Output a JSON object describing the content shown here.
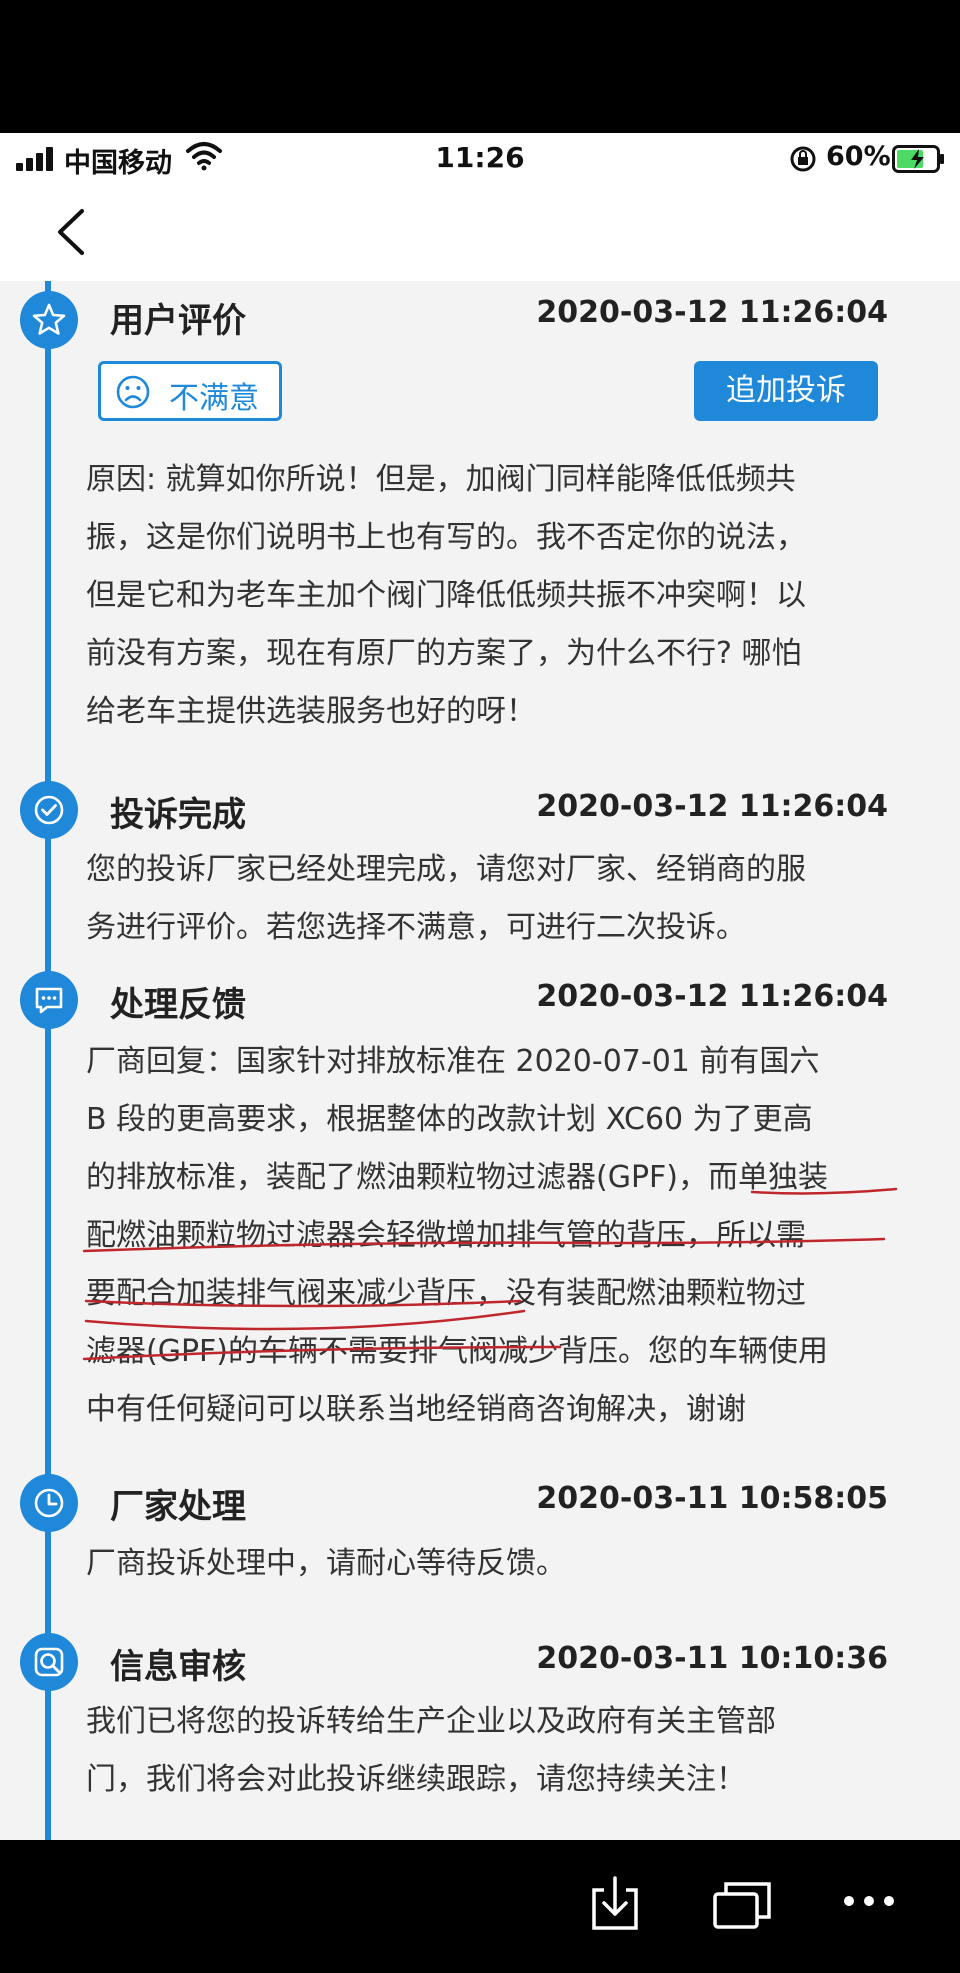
{
  "status_bar": {
    "carrier": "中国移动",
    "time": "11:26",
    "battery_percent": "60%"
  },
  "timeline": [
    {
      "icon": "star-icon",
      "title": "用户评价",
      "timestamp": "2020-03-12 11:26:04",
      "rating_label": "不满意",
      "action_button": "追加投诉",
      "lines": [
        "原因: 就算如你所说！但是，加阀门同样能降低低频共",
        "振，这是你们说明书上也有写的。我不否定你的说法，",
        "但是它和为老车主加个阀门降低低频共振不冲突啊！以",
        "前没有方案，现在有原厂的方案了，为什么不行? 哪怕",
        "给老车主提供选装服务也好的呀！"
      ]
    },
    {
      "icon": "check-circle-icon",
      "title": "投诉完成",
      "timestamp": "2020-03-12 11:26:04",
      "lines": [
        "您的投诉厂家已经处理完成，请您对厂家、经销商的服",
        "务进行评价。若您选择不满意，可进行二次投诉。"
      ]
    },
    {
      "icon": "message-icon",
      "title": "处理反馈",
      "timestamp": "2020-03-12 11:26:04",
      "lines": [
        "厂商回复：国家针对排放标准在 2020-07-01 前有国六",
        "B 段的更高要求，根据整体的改款计划 XC60 为了更高",
        "的排放标准，装配了燃油颗粒物过滤器(GPF)，而单独装",
        "配燃油颗粒物过滤器会轻微增加排气管的背压，所以需",
        "要配合加装排气阀来减少背压，没有装配燃油颗粒物过",
        "滤器(GPF)的车辆不需要排气阀减少背压。您的车辆使用",
        "中有任何疑问可以联系当地经销商咨询解决，谢谢"
      ]
    },
    {
      "icon": "clock-icon",
      "title": "厂家处理",
      "timestamp": "2020-03-11 10:58:05",
      "lines": [
        "厂商投诉处理中，请耐心等待反馈。"
      ]
    },
    {
      "icon": "search-review-icon",
      "title": "信息审核",
      "timestamp": "2020-03-11 10:10:36",
      "lines": [
        "我们已将您的投诉转给生产企业以及政府有关主管部",
        "门，我们将会对此投诉继续跟踪，请您持续关注！"
      ]
    }
  ],
  "colors": {
    "accent": "#1f88d8",
    "background": "#f3f3f3",
    "annotation": "#c0272d"
  }
}
